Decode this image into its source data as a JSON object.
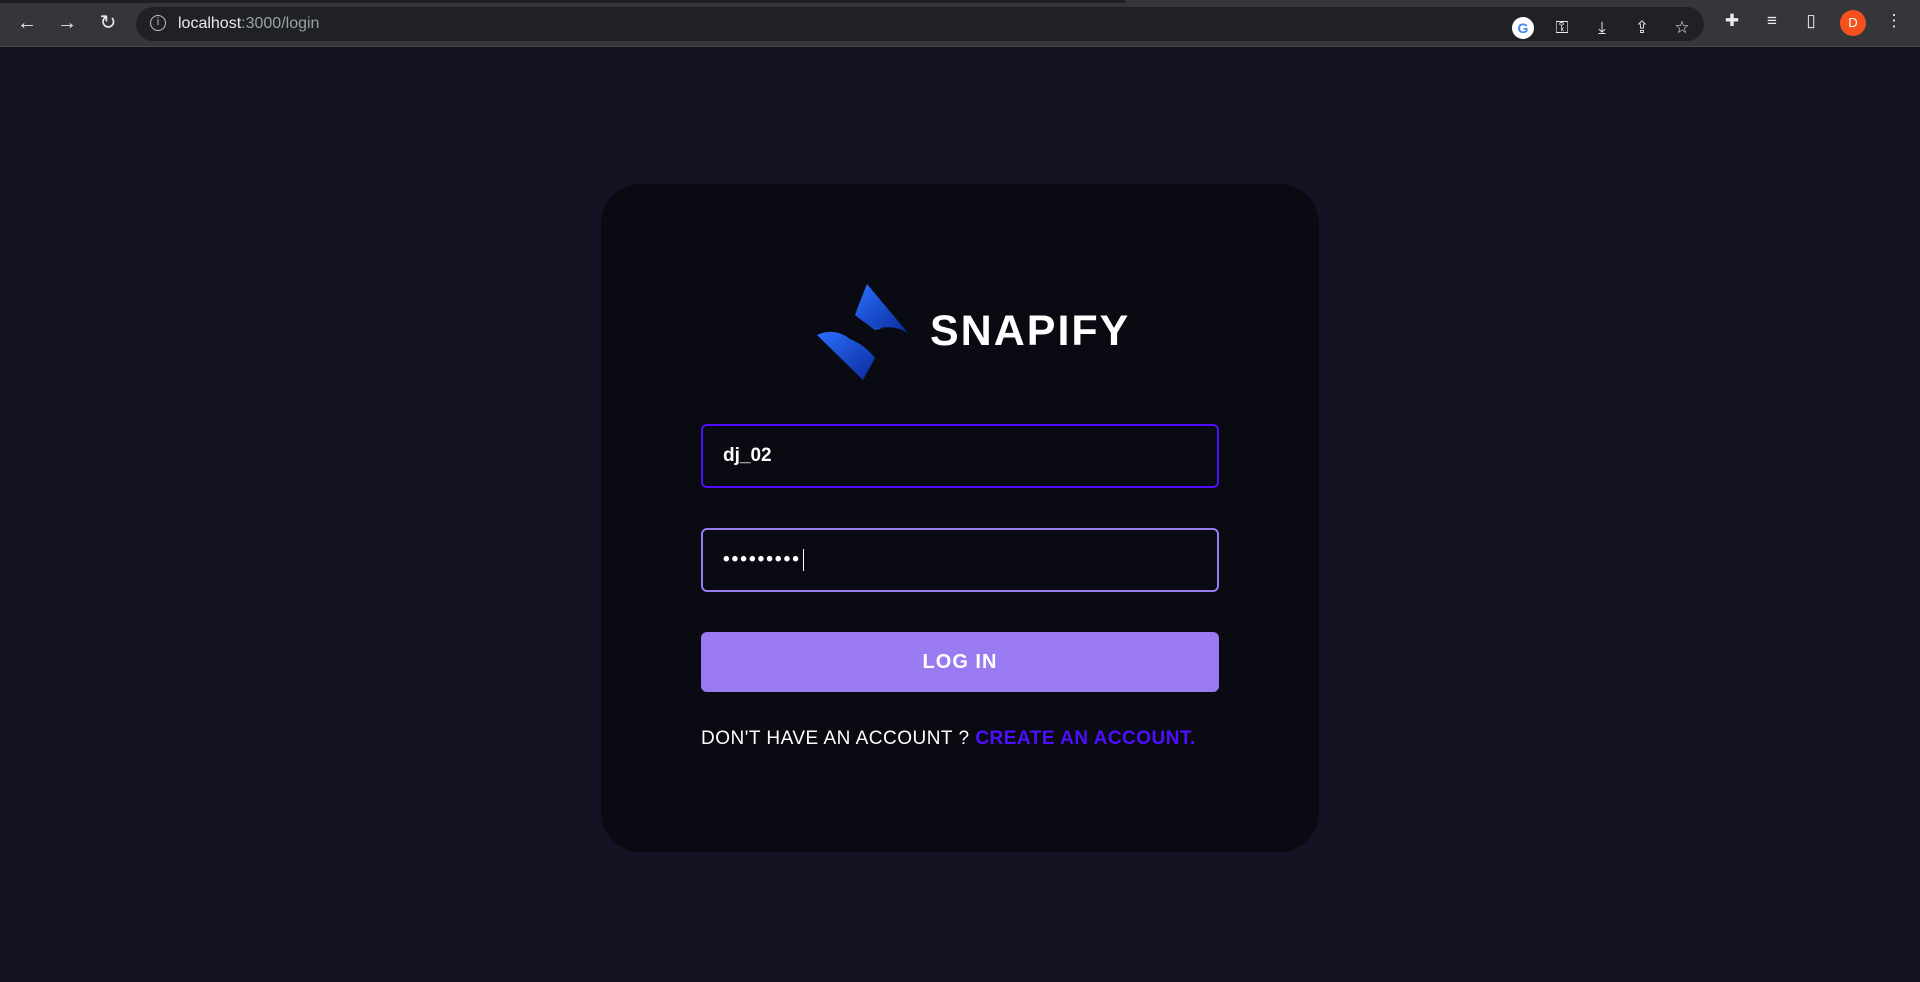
{
  "browser": {
    "url_host": "localhost",
    "url_path": ":3000/login",
    "avatar_letter": "D",
    "icons": [
      "back-icon",
      "forward-icon",
      "reload-icon",
      "info-icon",
      "google-icon",
      "key-icon",
      "install-icon",
      "share-icon",
      "star-icon",
      "extensions-icon",
      "reading-list-icon",
      "side-panel-icon",
      "menu-icon"
    ]
  },
  "login": {
    "brand": "SNAPIFY",
    "username_value": "dj_02",
    "password_value": "•••••••••",
    "submit_label": "LOG IN",
    "prompt": "DON'T HAVE AN ACCOUNT ?",
    "register_link": "CREATE AN ACCOUNT."
  },
  "colors": {
    "background": "#131324",
    "card": "#0a0a12",
    "accent": "#4e0eff",
    "button": "#997af0"
  }
}
